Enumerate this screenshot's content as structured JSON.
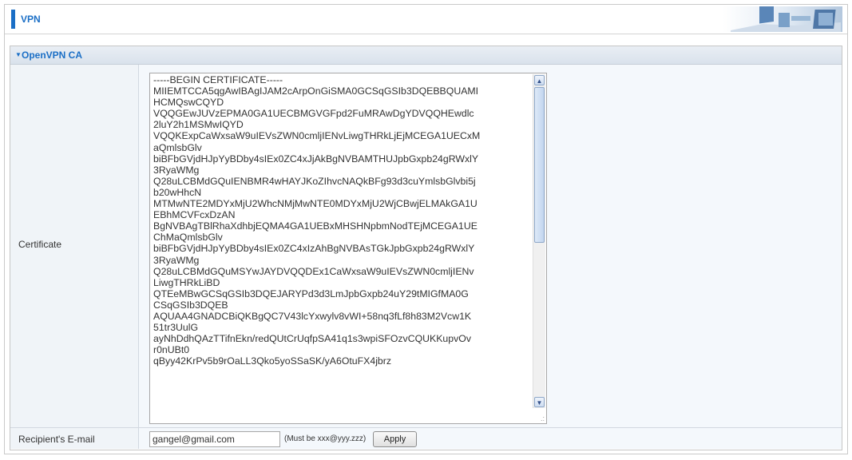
{
  "header": {
    "title": "VPN"
  },
  "section": {
    "title": "OpenVPN CA"
  },
  "certificate": {
    "label": "Certificate",
    "value": "-----BEGIN CERTIFICATE-----\nMIIEMTCCA5qgAwIBAgIJAM2cArpOnGiSMA0GCSqGSIb3DQEBBQUAMI\nHCMQswCQYD\nVQQGEwJUVzEPMA0GA1UECBMGVGFpd2FuMRAwDgYDVQQHEwdlc\n2luY2h1MSMwIQYD\nVQQKExpCaWxsaW9uIEVsZWN0cmljIENvLiwgTHRkLjEjMCEGA1UECxM\naQmlsbGlv\nbiBFbGVjdHJpYyBDby4sIEx0ZC4xJjAkBgNVBAMTHUJpbGxpb24gRWxlY\n3RyaWMg\nQ28uLCBMdGQuIENBMR4wHAYJKoZIhvcNAQkBFg93d3cuYmlsbGlvbi5j\nb20wHhcN\nMTMwNTE2MDYxMjU2WhcNMjMwNTE0MDYxMjU2WjCBwjELMAkGA1U\nEBhMCVFcxDzAN\nBgNVBAgTBlRhaXdhbjEQMA4GA1UEBxMHSHNpbmNodTEjMCEGA1UE\nChMaQmlsbGlv\nbiBFbGVjdHJpYyBDby4sIEx0ZC4xIzAhBgNVBAsTGkJpbGxpb24gRWxlY\n3RyaWMg\nQ28uLCBMdGQuMSYwJAYDVQQDEx1CaWxsaW9uIEVsZWN0cmljIENv\nLiwgTHRkLiBD\nQTEeMBwGCSqGSIb3DQEJARYPd3d3LmJpbGxpb24uY29tMIGfMA0G\nCSqGSIb3DQEB\nAQUAA4GNADCBiQKBgQC7V43lcYxwylv8vWI+58nq3fLf8h83M2Vcw1K\n51tr3UulG\nayNhDdhQAzTTifnEkn/redQUtCrUqfpSA41q1s3wpiSFOzvCQUKKupvOv\nr0nUBt0\nqByy42KrPv5b9rOaLL3Qko5yoSSaSK/yA6OtuFX4jbrz"
  },
  "recipient": {
    "label": "Recipient's E-mail",
    "value": "gangel@gmail.com",
    "hint": "(Must be xxx@yyy.zzz)",
    "apply_label": "Apply"
  },
  "icons": {
    "section_arrow": "triangle-down-icon",
    "scroll_up": "chevron-up-icon",
    "scroll_down": "chevron-down-icon",
    "resize": "resize-grip-icon"
  },
  "colors": {
    "accent": "#1b6fc6",
    "section_bg": "#dde5ee",
    "row_bg": "#f4f8fc"
  }
}
